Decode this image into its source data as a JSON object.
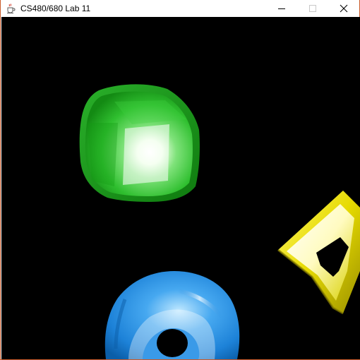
{
  "window": {
    "title": "CS480/680 Lab 11",
    "app_icon": "java-coffee-cup-icon",
    "controls": [
      {
        "name": "minimize",
        "icon": "minimize-icon"
      },
      {
        "name": "maximize",
        "icon": "maximize-icon",
        "disabled": true
      },
      {
        "name": "close",
        "icon": "close-icon"
      }
    ]
  },
  "scene": {
    "background_color": "#000000",
    "objects": [
      {
        "name": "cube",
        "shape": "rounded cube",
        "color": "#22b322"
      },
      {
        "name": "torus",
        "shape": "torus",
        "color": "#1e8fe6"
      },
      {
        "name": "square-ring",
        "shape": "square torus",
        "color": "#e8e000"
      }
    ]
  }
}
